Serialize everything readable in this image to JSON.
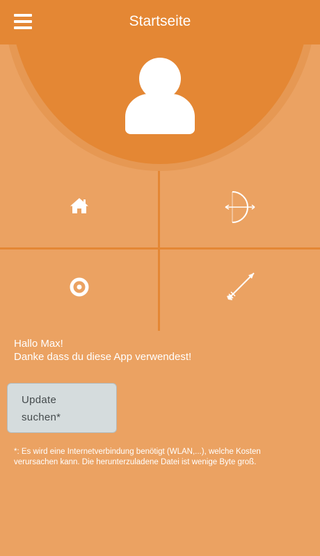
{
  "header": {
    "title": "Startseite",
    "menu_icon": "hamburger-menu-icon"
  },
  "profile": {
    "avatar_icon": "user-avatar-icon"
  },
  "tiles": [
    {
      "icon": "home-icon"
    },
    {
      "icon": "bow-icon"
    },
    {
      "icon": "target-icon"
    },
    {
      "icon": "arrow-icon"
    }
  ],
  "greeting": {
    "line1": "Hallo Max!",
    "line2": "Danke dass du diese App verwendest!"
  },
  "update": {
    "label_line1": "Update",
    "label_line2": "suchen*"
  },
  "footnote": {
    "text": "*: Es wird eine Internetverbindung benötigt (WLAN,...), welche Kosten verursachen kann. Die herunterzuladene Datei ist wenige Byte groß."
  },
  "colors": {
    "header": "#e48734",
    "background": "#eba262",
    "button": "#d5dcdd",
    "text": "#ffffff"
  }
}
